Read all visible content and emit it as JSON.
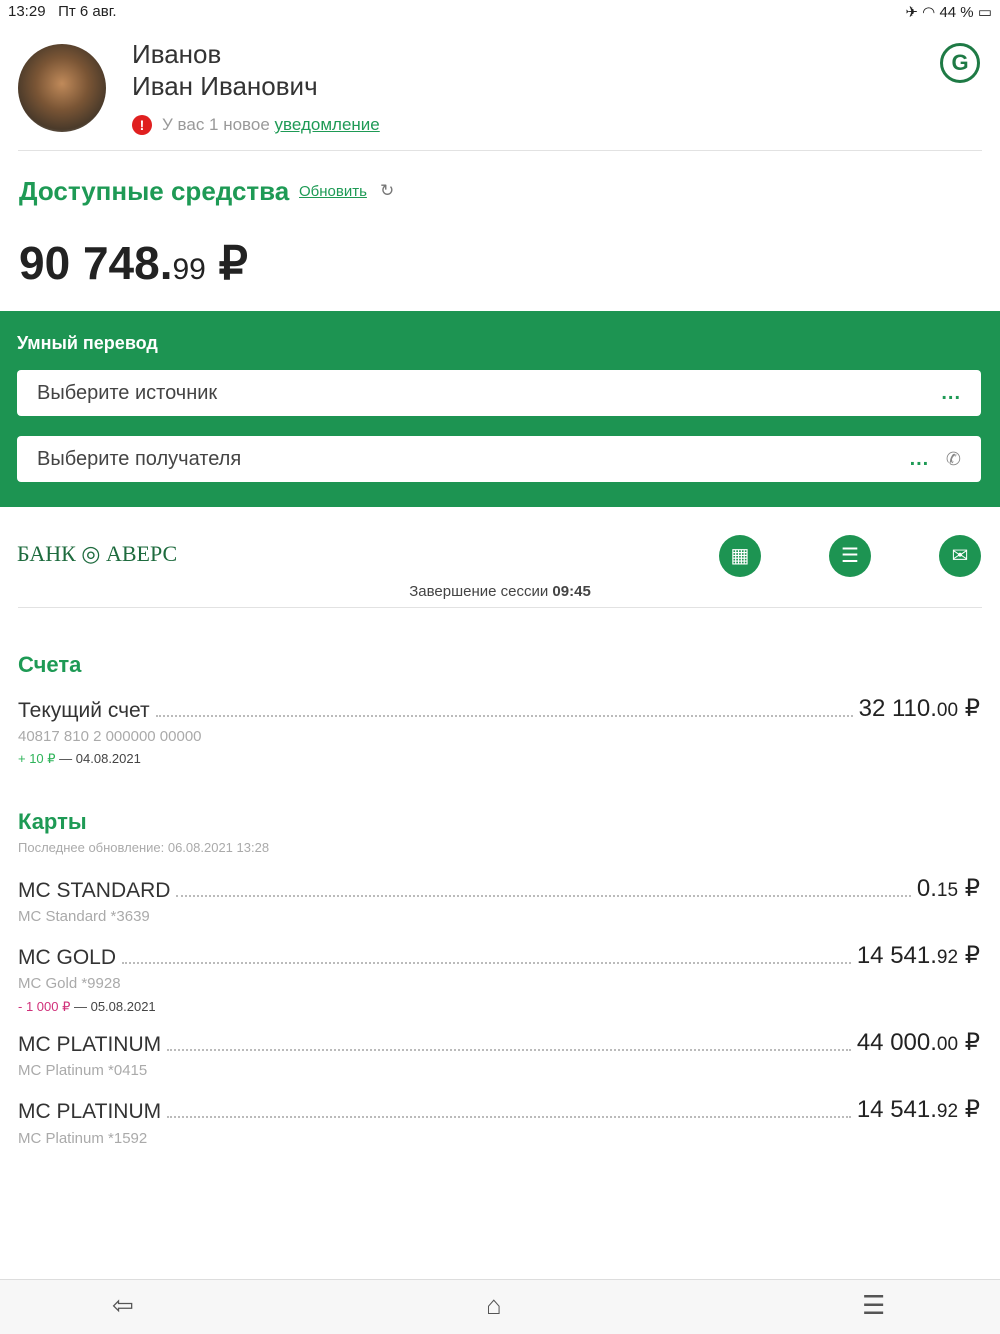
{
  "status": {
    "time": "13:29",
    "date": "Пт 6 авг.",
    "battery": "44 %"
  },
  "user": {
    "last_name": "Иванов",
    "first_names": "Иван Иванович",
    "notif_prefix": "У вас 1 новое",
    "notif_link": "уведомление"
  },
  "funds": {
    "title": "Доступные средства",
    "refresh": "Обновить",
    "amount_int": "90 748.",
    "amount_dec": "99",
    "currency": "₽"
  },
  "transfer": {
    "title": "Умный перевод",
    "source": "Выберите источник",
    "recipient": "Выберите получателя",
    "more": "..."
  },
  "bank": {
    "name": "БАНК ◎ АВЕРС",
    "session_label": "Завершение сессии",
    "session_time": "09:45"
  },
  "accounts": {
    "title": "Счета",
    "items": [
      {
        "name": "Текущий счет",
        "int": "32 110.",
        "dec": "00",
        "cur": "₽",
        "number": "40817 810 2 000000 00000",
        "change": "+ 10 ₽",
        "change_date": "— 04.08.2021"
      }
    ]
  },
  "cards": {
    "title": "Карты",
    "updated": "Последнее обновление: 06.08.2021 13:28",
    "items": [
      {
        "name": "MC STANDARD",
        "int": "0.",
        "dec": "15",
        "cur": "₽",
        "sub": "MC Standard *3639"
      },
      {
        "name": "MC GOLD",
        "int": "14 541.",
        "dec": "92",
        "cur": "₽",
        "sub": "MC Gold *9928",
        "change": "- 1 000 ₽",
        "change_date": "— 05.08.2021"
      },
      {
        "name": "MC PLATINUM",
        "int": "44 000.",
        "dec": "00",
        "cur": "₽",
        "sub": "MC Platinum *0415"
      },
      {
        "name": "MC PLATINUM",
        "int": "14 541.",
        "dec": "92",
        "cur": "₽",
        "sub": "MC Platinum *1592"
      }
    ]
  }
}
